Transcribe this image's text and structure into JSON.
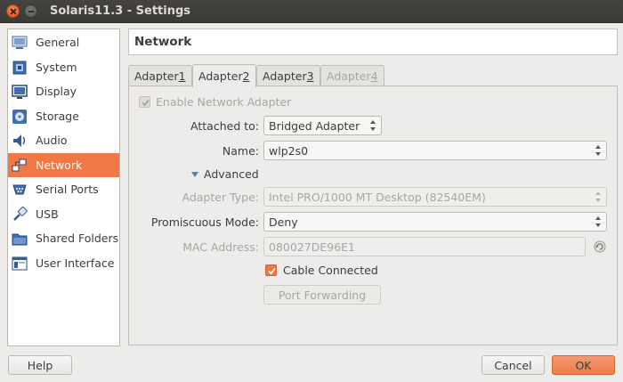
{
  "window": {
    "title": "Solaris11.3 - Settings"
  },
  "sidebar": {
    "items": [
      {
        "label": "General",
        "icon": "general-icon",
        "active": false
      },
      {
        "label": "System",
        "icon": "system-icon",
        "active": false
      },
      {
        "label": "Display",
        "icon": "display-icon",
        "active": false
      },
      {
        "label": "Storage",
        "icon": "storage-icon",
        "active": false
      },
      {
        "label": "Audio",
        "icon": "audio-icon",
        "active": false
      },
      {
        "label": "Network",
        "icon": "network-icon",
        "active": true
      },
      {
        "label": "Serial Ports",
        "icon": "serial-ports-icon",
        "active": false
      },
      {
        "label": "USB",
        "icon": "usb-icon",
        "active": false
      },
      {
        "label": "Shared Folders",
        "icon": "shared-folders-icon",
        "active": false
      },
      {
        "label": "User Interface",
        "icon": "user-interface-icon",
        "active": false
      }
    ]
  },
  "page": {
    "title": "Network"
  },
  "tabs": [
    {
      "text": "Adapter ",
      "num": "1",
      "active": false,
      "disabled": false
    },
    {
      "text": "Adapter ",
      "num": "2",
      "active": true,
      "disabled": false
    },
    {
      "text": "Adapter ",
      "num": "3",
      "active": false,
      "disabled": false
    },
    {
      "text": "Adapter ",
      "num": "4",
      "active": false,
      "disabled": true
    }
  ],
  "form": {
    "enable_adapter": {
      "label": "Enable Network Adapter",
      "checked": true,
      "enabled": false
    },
    "attached_to": {
      "label": "Attached to:",
      "value": "Bridged Adapter"
    },
    "name": {
      "label": "Name:",
      "value": "wlp2s0"
    },
    "advanced": {
      "label": "Advanced"
    },
    "adapter_type": {
      "label": "Adapter Type:",
      "value": "Intel PRO/1000 MT Desktop (82540EM)",
      "enabled": false
    },
    "promiscuous": {
      "label": "Promiscuous Mode:",
      "value": "Deny"
    },
    "mac": {
      "label": "MAC Address:",
      "value": "080027DE96E1",
      "enabled": false
    },
    "cable": {
      "label": "Cable Connected",
      "checked": true
    },
    "port_forwarding": {
      "label": "Port Forwarding",
      "enabled": false
    }
  },
  "footer": {
    "help_label": "Help",
    "cancel_label": "Cancel",
    "ok_label": "OK"
  },
  "colors": {
    "accent": "#f07746",
    "link_blue": "#4d7ec4"
  }
}
